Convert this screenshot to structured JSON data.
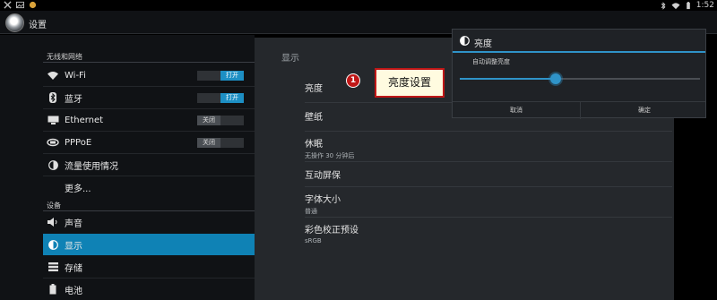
{
  "status_bar": {
    "time": "1:52",
    "left_icons": [
      "close-icon",
      "image-icon",
      "usb-icon"
    ],
    "right_icons": [
      "bluetooth-icon",
      "wifi-icon",
      "battery-icon"
    ]
  },
  "action_bar": {
    "title": "设置",
    "icon": "settings-app-icon"
  },
  "sidebar": {
    "sections": [
      {
        "header": "无线和网络"
      },
      {
        "header": "设备"
      }
    ],
    "items": [
      {
        "label": "Wi-Fi",
        "icon": "wifi-icon",
        "toggle": "打开",
        "toggle_state": "on"
      },
      {
        "label": "蓝牙",
        "icon": "bluetooth-icon",
        "toggle": "打开",
        "toggle_state": "on"
      },
      {
        "label": "Ethernet",
        "icon": "ethernet-icon",
        "toggle": "关闭",
        "toggle_state": "off"
      },
      {
        "label": "PPPoE",
        "icon": "pppoe-icon",
        "toggle": "关闭",
        "toggle_state": "off"
      },
      {
        "label": "流量使用情况",
        "icon": "data-usage-icon"
      },
      {
        "label": "更多...",
        "icon": ""
      },
      {
        "label": "声音",
        "icon": "sound-icon"
      },
      {
        "label": "显示",
        "icon": "display-icon",
        "selected": true
      },
      {
        "label": "存储",
        "icon": "storage-icon"
      },
      {
        "label": "电池",
        "icon": "battery-icon"
      }
    ]
  },
  "detail": {
    "title": "显示",
    "items": [
      {
        "title": "亮度",
        "summary": ""
      },
      {
        "title": "壁纸",
        "summary": ""
      },
      {
        "title": "休眠",
        "summary": "无操作 30 分钟后"
      },
      {
        "title": "互动屏保",
        "summary": ""
      },
      {
        "title": "字体大小",
        "summary": "普通"
      },
      {
        "title": "彩色校正预设",
        "summary": "sRGB"
      }
    ]
  },
  "callout": {
    "number": "1",
    "text": "亮度设置"
  },
  "dialog": {
    "title": "亮度",
    "auto_label": "自动调整亮度",
    "slider_value": 0.4,
    "cancel": "取消",
    "ok": "确定"
  },
  "colors": {
    "accent": "#2f93c8",
    "selected_row": "#0f82b5",
    "callout_red": "#c01717"
  }
}
